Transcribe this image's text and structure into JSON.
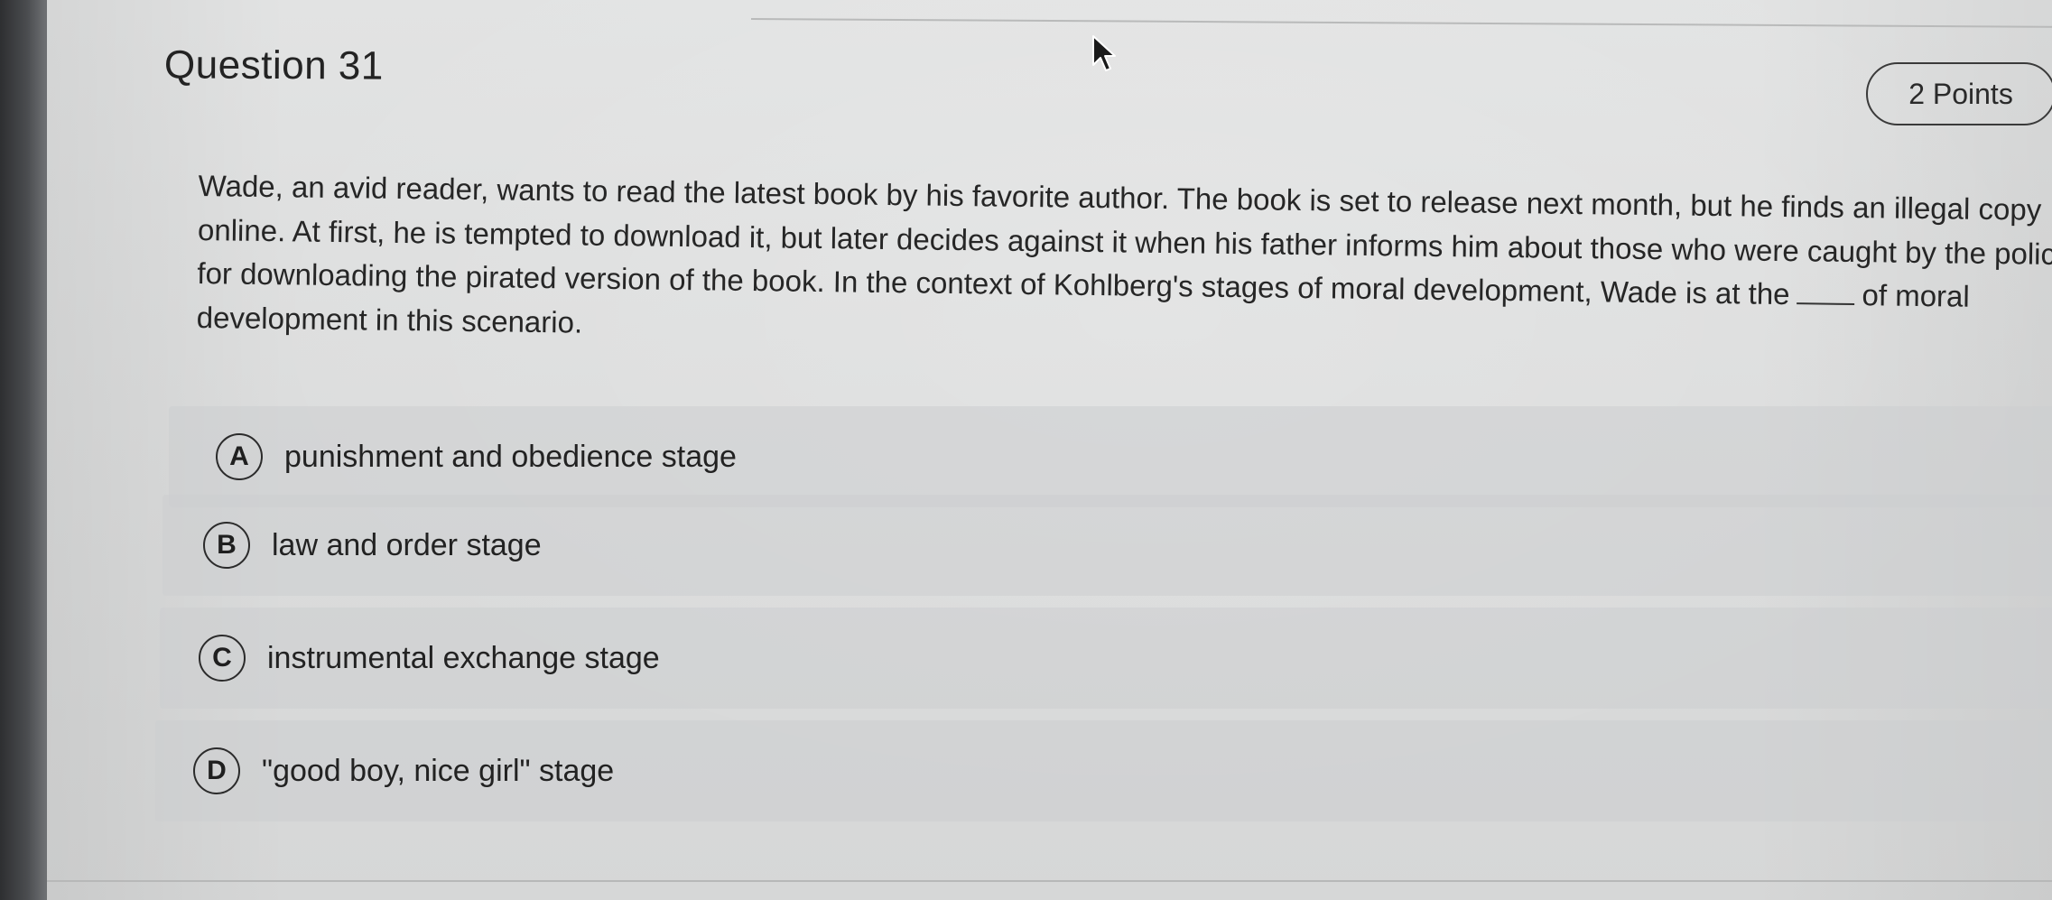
{
  "question": {
    "title": "Question 31",
    "points": "2 Points",
    "text_part1": "Wade, an avid reader, wants to read the latest book by his favorite author. The book is set to release next month, but he finds an illegal copy online. At first, he is tempted to download it, but later decides against it when his father informs him about those who were caught by the police for downloading the pirated version of the book. In the context of Kohlberg's stages of moral development, Wade is at the",
    "text_part2": "of moral development in this scenario."
  },
  "options": [
    {
      "letter": "A",
      "text": "punishment and obedience stage"
    },
    {
      "letter": "B",
      "text": "law and order stage"
    },
    {
      "letter": "C",
      "text": "instrumental exchange stage"
    },
    {
      "letter": "D",
      "text": "\"good boy, nice girl\" stage"
    }
  ],
  "icons": {
    "cursor": "mouse-pointer-icon"
  }
}
